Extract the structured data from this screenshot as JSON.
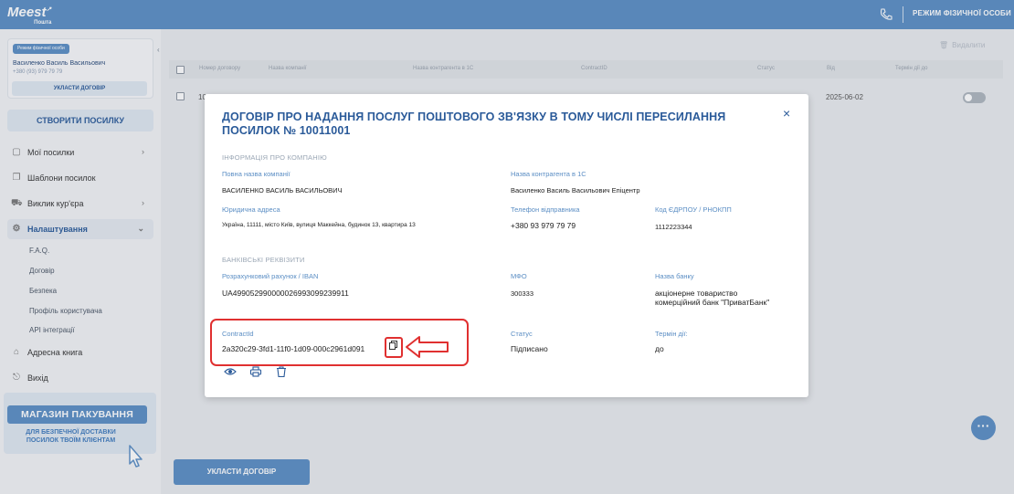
{
  "header": {
    "logo_text": "Meest",
    "logo_sub": "Пошта",
    "mode_label": "РЕЖИМ ФІЗИЧНОЇ ОСОБИ",
    "phone_icon": "phone-icon"
  },
  "sidebar": {
    "user": {
      "mode_badge": "Режим фізичної особи",
      "name": "Василенко Василь Васильович",
      "phone": "+380 (93) 979 79 79",
      "conclude_label": "УКЛАСТИ ДОГОВІР"
    },
    "create_parcel_label": "СТВОРИТИ ПОСИЛКУ",
    "menu": [
      {
        "label": "Мої посилки",
        "icon": "box-icon",
        "chevron": "›"
      },
      {
        "label": "Шаблони посилок",
        "icon": "template-icon",
        "chevron": ""
      },
      {
        "label": "Виклик кур'єра",
        "icon": "truck-icon",
        "chevron": "›"
      },
      {
        "label": "Налаштування",
        "icon": "gear-icon",
        "chevron": "⌄"
      },
      {
        "label": "Адресна книга",
        "icon": "address-book-icon",
        "chevron": ""
      },
      {
        "label": "Вихід",
        "icon": "logout-icon",
        "chevron": ""
      }
    ],
    "submenu": [
      "F.A.Q.",
      "Договір",
      "Безпека",
      "Профіль користувача",
      "API інтеграції"
    ],
    "shop": {
      "title": "МАГАЗИН ПАКУВАННЯ",
      "subtitle": "ДЛЯ БЕЗПЕЧНОЇ ДОСТАВКИ ПОСИЛОК ТВОЇМ КЛІЄНТАМ"
    }
  },
  "main": {
    "delete_label": "Видалити",
    "columns": [
      "Номер договору",
      "Назва компанії",
      "Назва контрагента в 1С",
      "ContractID",
      "Статус",
      "Від",
      "Термін дії до"
    ],
    "row": {
      "number": "10",
      "from_date": "2025-06-02"
    },
    "conclude_label": "УКЛАСТИ ДОГОВІР"
  },
  "modal": {
    "title": "ДОГОВІР ПРО НАДАННЯ ПОСЛУГ ПОШТОВОГО ЗВ'ЯЗКУ В ТОМУ ЧИСЛІ ПЕРЕСИЛАННЯ ПОСИЛОК № 10011001",
    "company_section": "ІНФОРМАЦІЯ ПРО КОМПАНІЮ",
    "full_name_label": "Повна назва компанії",
    "full_name_value": "ВАСИЛЕНКО ВАСИЛЬ ВАСИЛЬОВИЧ",
    "contractor_label": "Назва контрагента в 1С",
    "contractor_value": "Василенко Василь Васильович Епіцентр",
    "legal_address_label": "Юридична адреса",
    "legal_address_value": "Україна, 11111, місто Київ, вулиця Маккейна, будинок 13, квартира 13",
    "sender_phone_label": "Телефон відправника",
    "sender_phone_value": "+380 93 979 79 79",
    "edrpou_label": "Код ЄДРПОУ / РНОКПП",
    "edrpou_value": "1112223344",
    "bank_section": "БАНКІВСЬКІ РЕКВІЗИТИ",
    "iban_label": "Розрахунковий рахунок / IBAN",
    "iban_value": "UA499052990000026993099239911",
    "mfo_label": "МФО",
    "mfo_value": "300333",
    "bank_name_label": "Назва банку",
    "bank_name_value": "акціонерне товариство комерційний банк \"ПриватБанк\"",
    "contract_id_label": "ContractId",
    "contract_id_value": "2a320c29-3fd1-11f0-1d09-000c2961d091",
    "status_label": "Статус",
    "status_value": "Підписано",
    "term_label": "Термін дії:",
    "term_value": "до",
    "close_icon": "×"
  },
  "colors": {
    "brand_blue": "#5b8ec4",
    "title_blue": "#2a5a99",
    "highlight_red": "#e03030"
  }
}
